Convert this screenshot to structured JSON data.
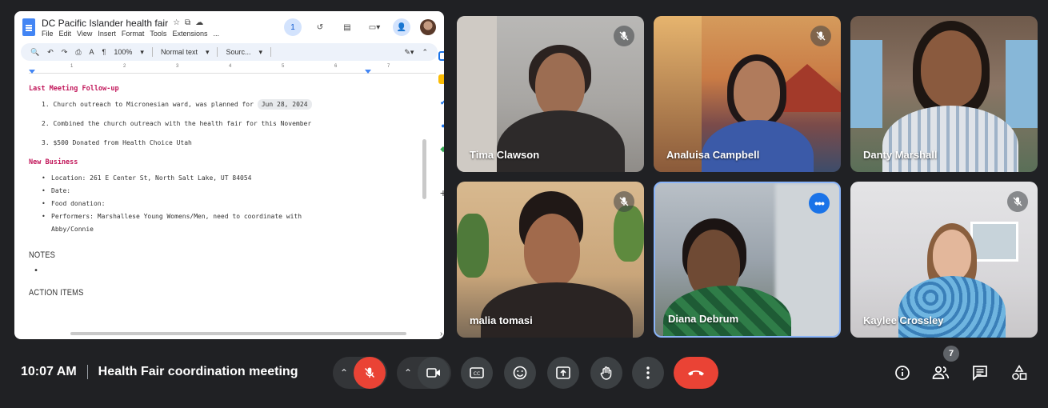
{
  "doc": {
    "title": "DC Pacific Islander health fair",
    "menu": [
      "File",
      "Edit",
      "View",
      "Insert",
      "Format",
      "Tools",
      "Extensions",
      "..."
    ],
    "toolbar": {
      "zoom": "100%",
      "style": "Normal text",
      "font": "Sourc...",
      "size": ""
    },
    "section_followup": "Last Meeting Follow-up",
    "followup_items": [
      "1. Church outreach to Micronesian ward, was planned for",
      "2. Combined the church outreach with the health fair for this November",
      "3. $500 Donated from Health Choice Utah"
    ],
    "followup_date_chip": "Jun 28, 2024",
    "section_new": "New Business",
    "new_items": [
      "Location: 261 E Center St, North Salt Lake, UT 84054",
      "Date:",
      "Food donation:",
      "Performers: Marshallese Young Womens/Men, need to coordinate with"
    ],
    "new_items_wrap": "Abby/Connie",
    "section_notes": "NOTES",
    "section_actions": "ACTION ITEMS",
    "ruler_marks": [
      "1",
      "2",
      "3",
      "4",
      "5",
      "6",
      "7"
    ]
  },
  "participants": [
    {
      "name": "Tima Clawson",
      "muted": true
    },
    {
      "name": "Analuisa Campbell",
      "muted": true
    },
    {
      "name": "Danty Marshall",
      "muted": false
    },
    {
      "name": "malia tomasi",
      "muted": true
    },
    {
      "name": "Diana Debrum",
      "muted": false
    },
    {
      "name": "Kaylee Crossley",
      "muted": true
    }
  ],
  "meeting": {
    "time": "10:07 AM",
    "title": "Health Fair coordination meeting",
    "participant_count": "7"
  },
  "colors": {
    "background": "#202124",
    "end_call": "#ea4335",
    "active_speaker": "#8ab4f8",
    "doc_heading": "#c2185b"
  }
}
